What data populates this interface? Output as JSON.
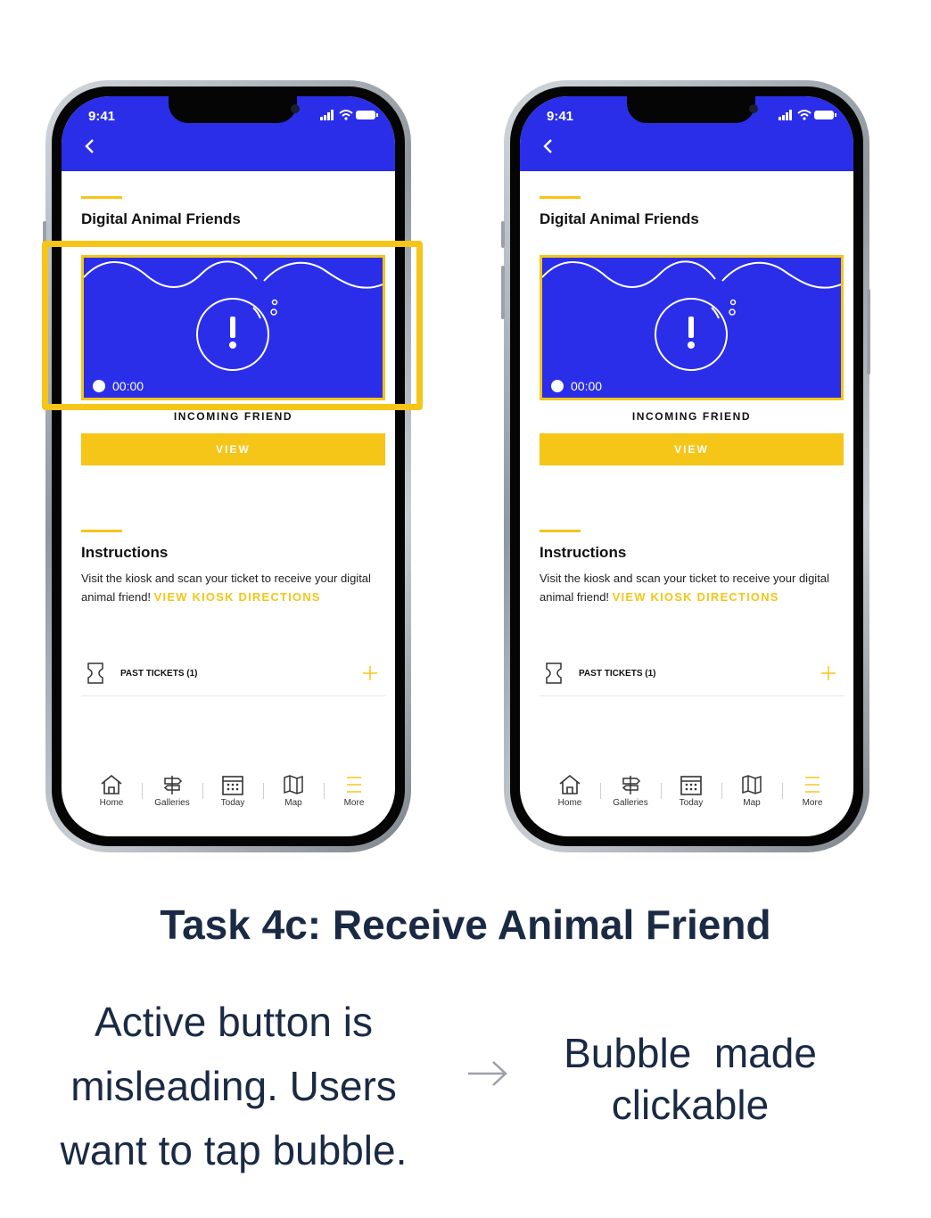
{
  "phones": [
    {
      "status_time": "9:41",
      "page_title": "Digital Animal Friends",
      "timer": "00:00",
      "incoming_label": "INCOMING FRIEND",
      "view_label": "VIEW",
      "instructions_title": "Instructions",
      "instructions_text": "Visit the kiosk and scan your ticket to receive your digital animal friend!",
      "kiosk_link": "VIEW KIOSK DIRECTIONS",
      "past_tickets": "PAST TICKETS (1)",
      "nav": [
        "Home",
        "Galleries",
        "Today",
        "Map",
        "More"
      ]
    },
    {
      "status_time": "9:41",
      "page_title": "Digital Animal Friends",
      "timer": "00:00",
      "incoming_label": "INCOMING FRIEND",
      "view_label": "VIEW",
      "instructions_title": "Instructions",
      "instructions_text": "Visit the kiosk and scan your ticket to receive your digital animal friend!",
      "kiosk_link": "VIEW KIOSK DIRECTIONS",
      "past_tickets": "PAST TICKETS (1)",
      "nav": [
        "Home",
        "Galleries",
        "Today",
        "Map",
        "More"
      ]
    }
  ],
  "task_title": "Task 4c: Receive Animal Friend",
  "note_left": [
    "Active button is",
    "misleading. Users",
    "want to tap bubble."
  ],
  "note_right": [
    "Bubble  made",
    "clickable"
  ],
  "colors": {
    "brand_blue": "#2b2ee8",
    "accent_yellow": "#f5c518",
    "text_dark": "#1a2a44"
  }
}
